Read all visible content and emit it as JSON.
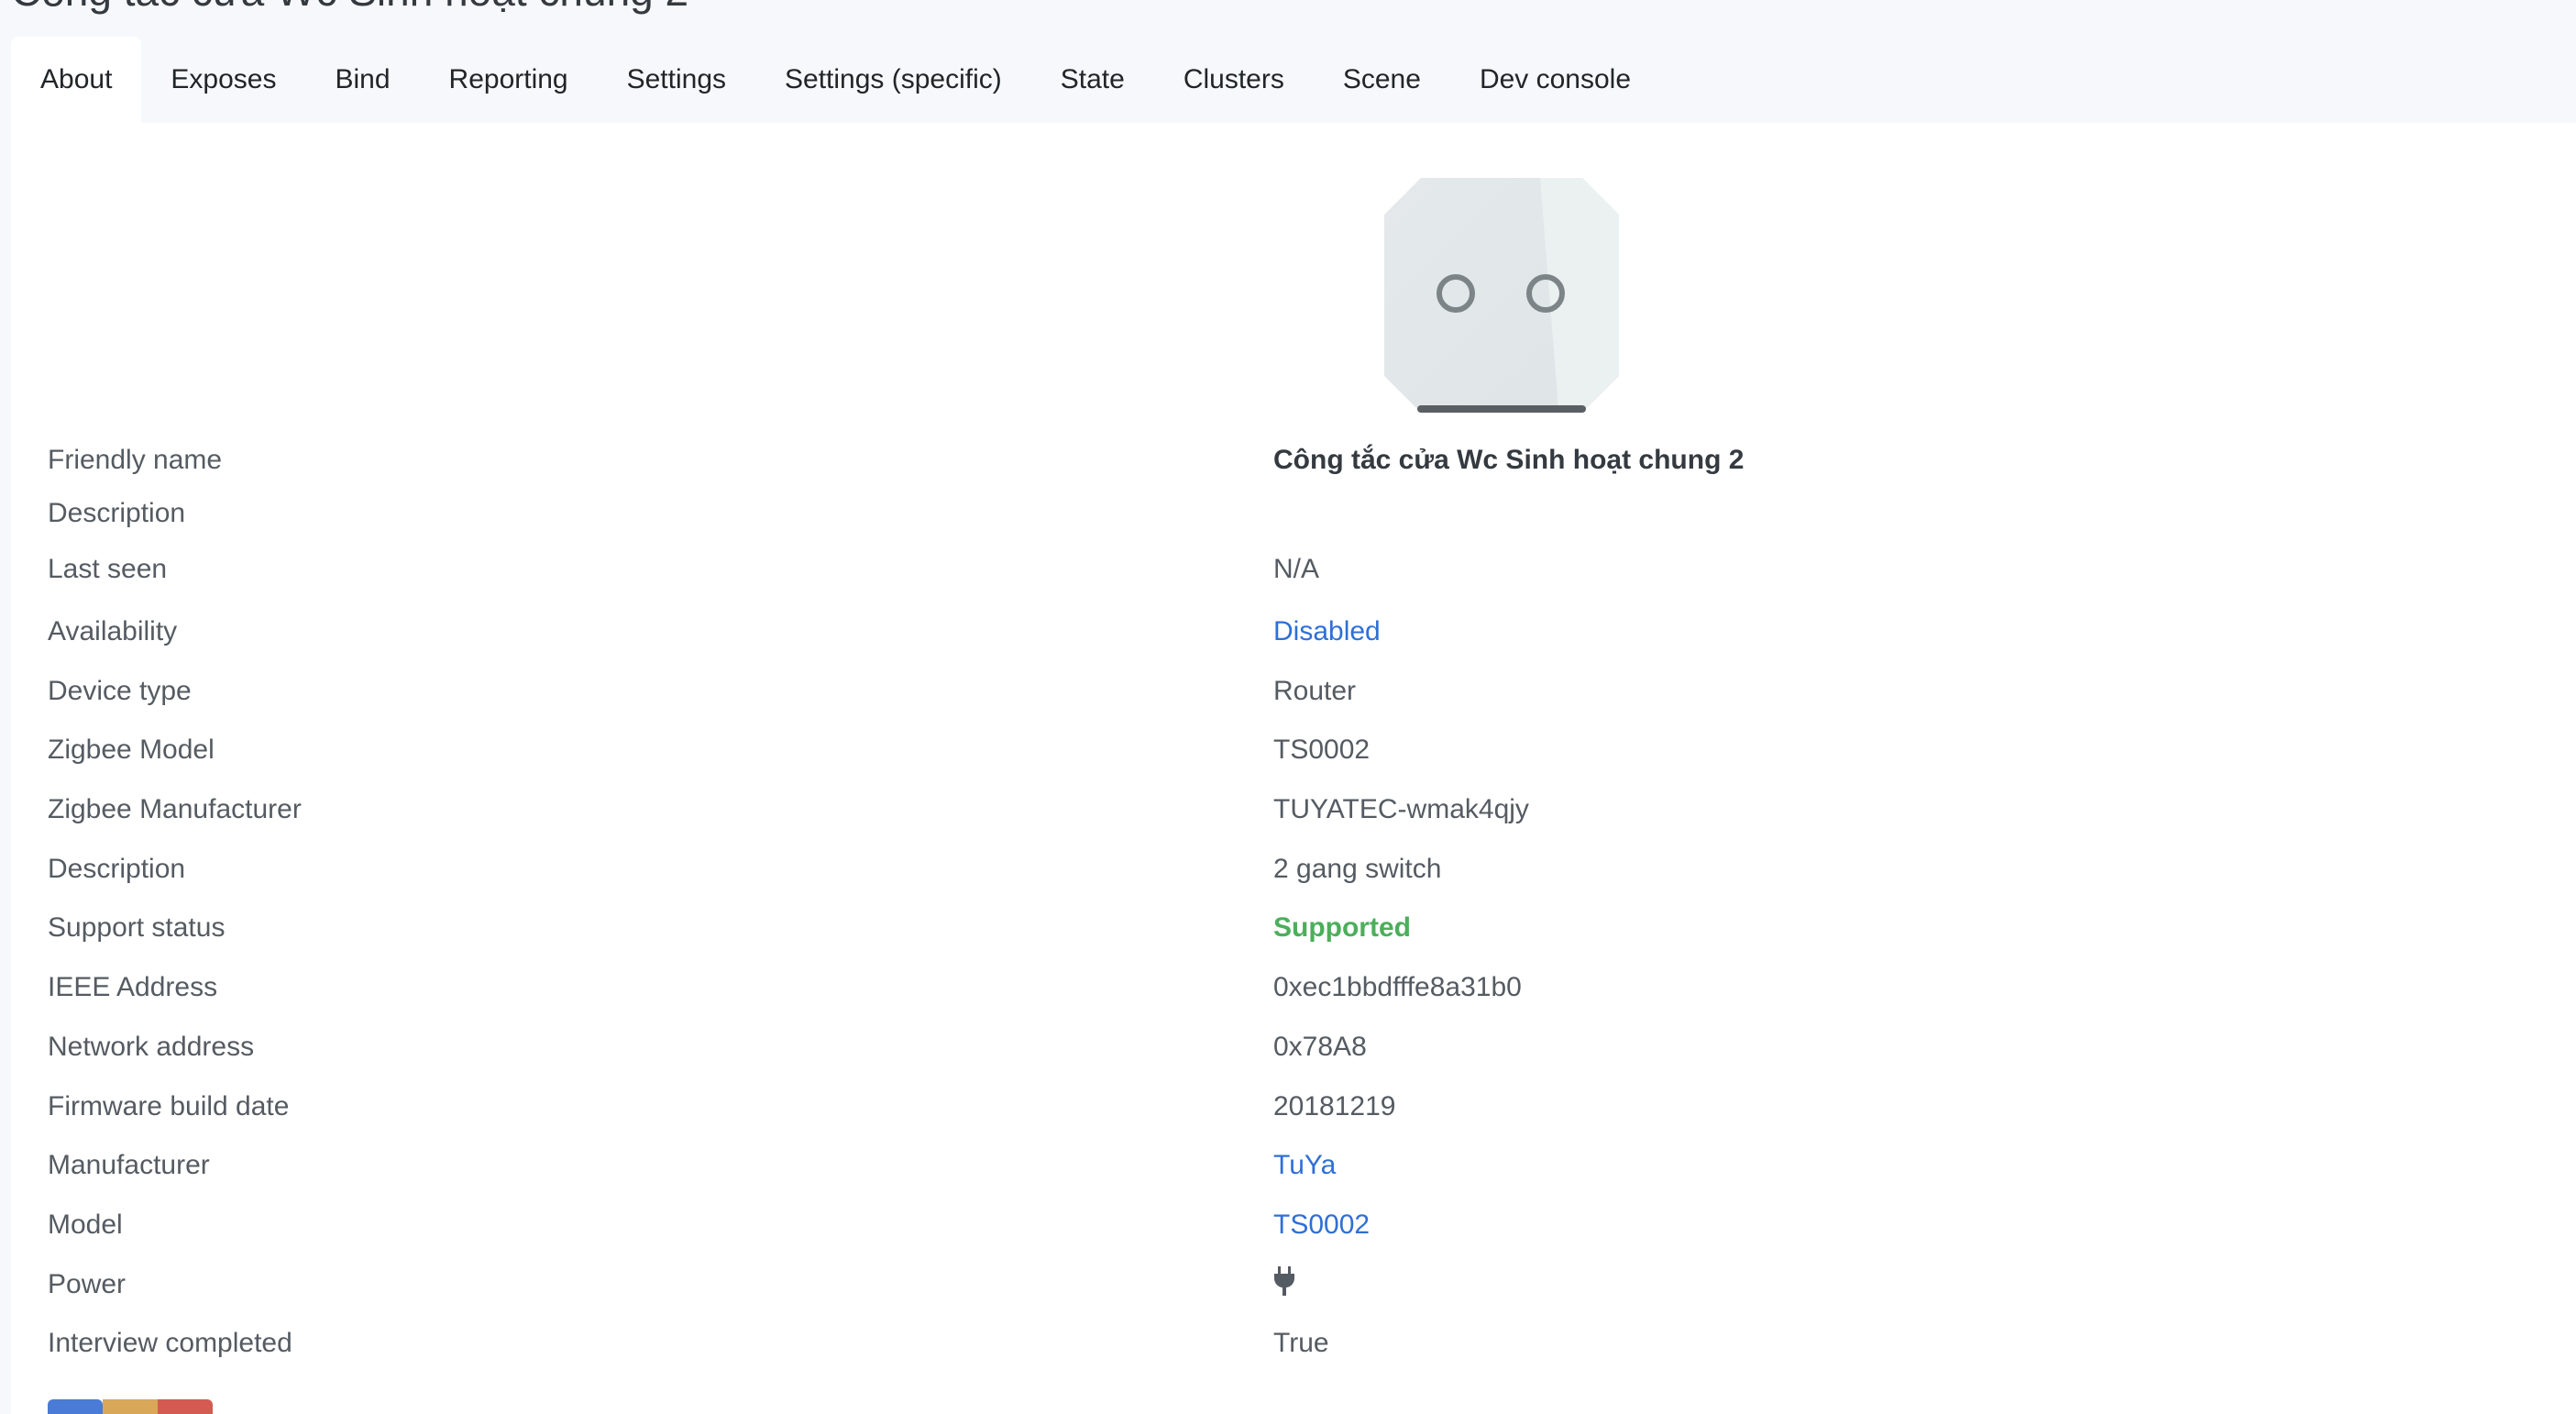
{
  "page": {
    "title": "Công tắc cửa Wc Sinh hoạt chung 2"
  },
  "tabs": [
    {
      "label": "About",
      "active": true
    },
    {
      "label": "Exposes"
    },
    {
      "label": "Bind"
    },
    {
      "label": "Reporting"
    },
    {
      "label": "Settings"
    },
    {
      "label": "Settings (specific)"
    },
    {
      "label": "State"
    },
    {
      "label": "Clusters"
    },
    {
      "label": "Scene"
    },
    {
      "label": "Dev console"
    }
  ],
  "device_image": {
    "icon": "wall-switch-2-gang-image"
  },
  "details": {
    "friendly_name": {
      "label": "Friendly name",
      "value": "Công tắc cửa Wc Sinh hoạt chung 2"
    },
    "description_edit": {
      "label": "Description"
    },
    "last_seen": {
      "label": "Last seen",
      "value": "N/A"
    },
    "availability": {
      "label": "Availability",
      "value": "Disabled"
    },
    "device_type": {
      "label": "Device type",
      "value": "Router"
    },
    "zigbee_model": {
      "label": "Zigbee Model",
      "value": "TS0002"
    },
    "zigbee_manufacturer": {
      "label": "Zigbee Manufacturer",
      "value": "TUYATEC-wmak4qjy"
    },
    "description": {
      "label": "Description",
      "value": "2 gang switch"
    },
    "support_status": {
      "label": "Support status",
      "value": "Supported"
    },
    "ieee_address": {
      "label": "IEEE Address",
      "value": "0xec1bbdfffe8a31b0"
    },
    "network_address": {
      "label": "Network address",
      "value": "0x78A8"
    },
    "firmware_build_date": {
      "label": "Firmware build date",
      "value": "20181219"
    },
    "manufacturer": {
      "label": "Manufacturer",
      "value": "TuYa"
    },
    "model": {
      "label": "Model",
      "value": "TS0002"
    },
    "power": {
      "label": "Power",
      "icon": "plug-icon"
    },
    "interview_completed": {
      "label": "Interview completed",
      "value": "True"
    }
  },
  "colors": {
    "link": "#2f6fd6",
    "success": "#4cae5b",
    "label_text": "#555b62"
  }
}
